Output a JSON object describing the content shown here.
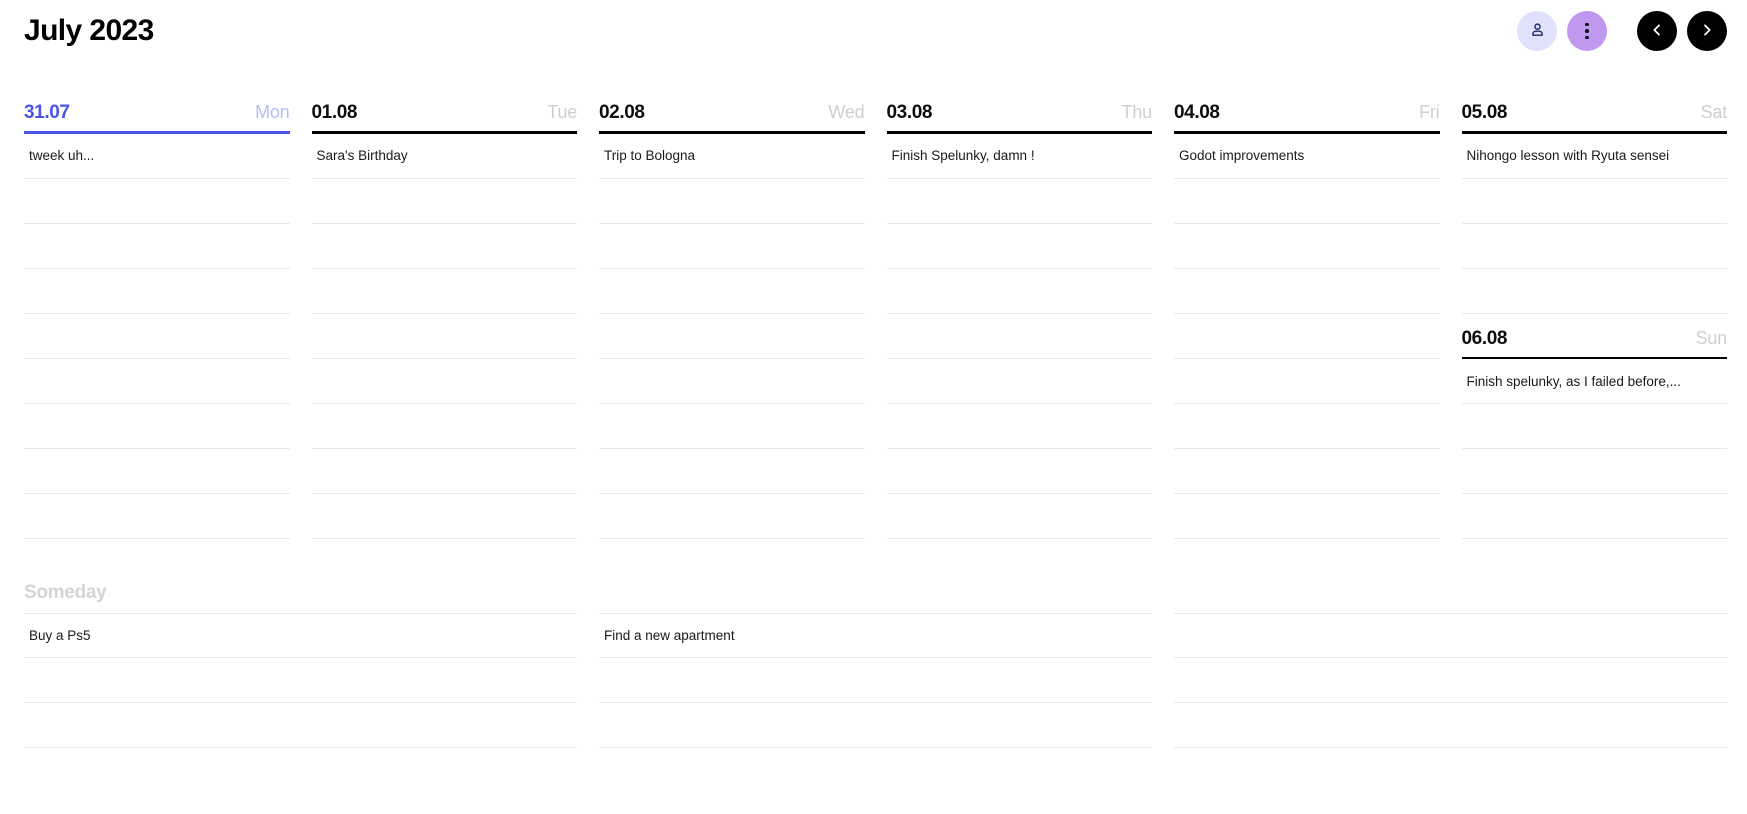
{
  "header": {
    "title": "July 2023",
    "buttons": [
      {
        "name": "profile-button",
        "icon": "user-icon",
        "color": "#e0e2fb"
      },
      {
        "name": "more-options-button",
        "icon": "vertical-dots-icon",
        "color": "#bf99ef"
      },
      {
        "name": "previous-week-button",
        "icon": "chevron-left-icon",
        "color": "#000000"
      },
      {
        "name": "next-week-button",
        "icon": "chevron-right-icon",
        "color": "#000000"
      }
    ]
  },
  "accent": {
    "today_blue": "#4a53ea",
    "today_blue_muted": "#b8bcf4",
    "rule_black": "#000000",
    "row_divider": "#e9e9e9",
    "muted_text": "#cfcfcf",
    "someday_heading": "#d4d4d4",
    "profile_bg": "#e0e2fb",
    "menu_bg": "#bf99ef",
    "nav_bg": "#000000"
  },
  "week": {
    "days": [
      {
        "date": "31.07",
        "weekday": "Mon",
        "today": true,
        "tasks": [
          "tweek uh..."
        ],
        "empty_rows": 8
      },
      {
        "date": "01.08",
        "weekday": "Tue",
        "today": false,
        "tasks": [
          "Sara's Birthday"
        ],
        "empty_rows": 8
      },
      {
        "date": "02.08",
        "weekday": "Wed",
        "today": false,
        "tasks": [
          "Trip to Bologna"
        ],
        "empty_rows": 8
      },
      {
        "date": "03.08",
        "weekday": "Thu",
        "today": false,
        "tasks": [
          "Finish Spelunky, damn !"
        ],
        "empty_rows": 8
      },
      {
        "date": "04.08",
        "weekday": "Fri",
        "today": false,
        "tasks": [
          "Godot improvements"
        ],
        "empty_rows": 8
      },
      {
        "date": "05.08",
        "weekday": "Sat",
        "today": false,
        "tasks": [
          "Nihongo lesson with Ryuta sensei"
        ],
        "empty_rows": 3,
        "sub_day": {
          "date": "06.08",
          "weekday": "Sun",
          "today": false,
          "tasks": [
            "Finish spelunky, as I failed before,..."
          ],
          "empty_rows": 3
        }
      }
    ]
  },
  "someday": {
    "title": "Someday",
    "columns": [
      {
        "tasks": [
          "Buy a Ps5"
        ],
        "empty_rows": 2
      },
      {
        "tasks": [
          "Find a new apartment"
        ],
        "empty_rows": 2
      },
      {
        "tasks": [],
        "empty_rows": 3
      }
    ]
  }
}
